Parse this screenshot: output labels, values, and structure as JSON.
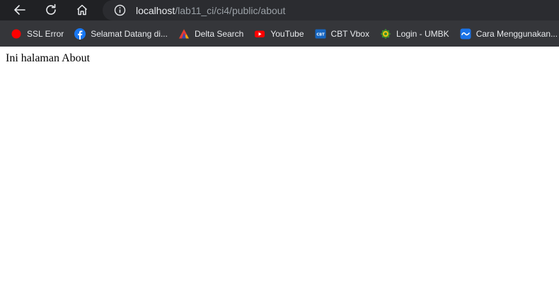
{
  "toolbar": {
    "url_host": "localhost",
    "url_path": "/lab11_ci/ci4/public/about"
  },
  "bookmarks": [
    {
      "label": "SSL Error",
      "icon": "red-dot-icon",
      "color": "#ff0000"
    },
    {
      "label": "Selamat Datang di...",
      "icon": "facebook-icon",
      "color": "#1877f2"
    },
    {
      "label": "Delta Search",
      "icon": "delta-icon",
      "color": "#f4a300"
    },
    {
      "label": "YouTube",
      "icon": "youtube-icon",
      "color": "#ff0000"
    },
    {
      "label": "CBT Vbox",
      "icon": "cbt-icon",
      "color": "#1565c0"
    },
    {
      "label": "Login - UMBK",
      "icon": "umbk-icon",
      "color": "#3c8d2f"
    },
    {
      "label": "Cara Menggunakan...",
      "icon": "wave-icon",
      "color": "#1a73e8"
    }
  ],
  "page": {
    "text": "Ini halaman About"
  },
  "colors": {
    "toolbar_bg": "#202124",
    "omnibox_bg": "#2b2c30",
    "bookmarks_bg": "#35363a",
    "page_bg": "#ffffff"
  }
}
